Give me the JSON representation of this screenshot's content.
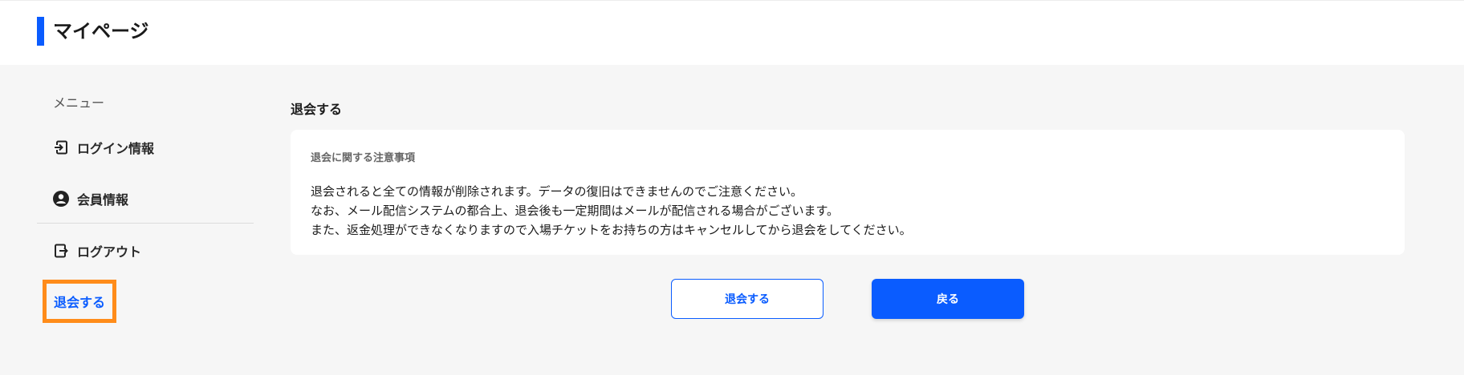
{
  "header": {
    "title": "マイページ",
    "accent_color": "#0a5cff"
  },
  "sidebar": {
    "caption": "メニュー",
    "items": [
      {
        "label": "ログイン情報",
        "icon": "login-icon"
      },
      {
        "label": "会員情報",
        "icon": "user-circle-icon"
      },
      {
        "label": "ログアウト",
        "icon": "logout-icon"
      }
    ],
    "withdraw_label": "退会する",
    "highlight_color": "#ff8c1a"
  },
  "main": {
    "section_title": "退会する",
    "notice": {
      "heading": "退会に関する注意事項",
      "lines": [
        "退会されると全ての情報が削除されます。データの復旧はできませんのでご注意ください。",
        "なお、メール配信システムの都合上、退会後も一定期間はメールが配信される場合がございます。",
        "また、返金処理ができなくなりますので入場チケットをお持ちの方はキャンセルしてから退会をしてください。"
      ]
    },
    "buttons": {
      "withdraw_label": "退会する",
      "back_label": "戻る"
    }
  }
}
